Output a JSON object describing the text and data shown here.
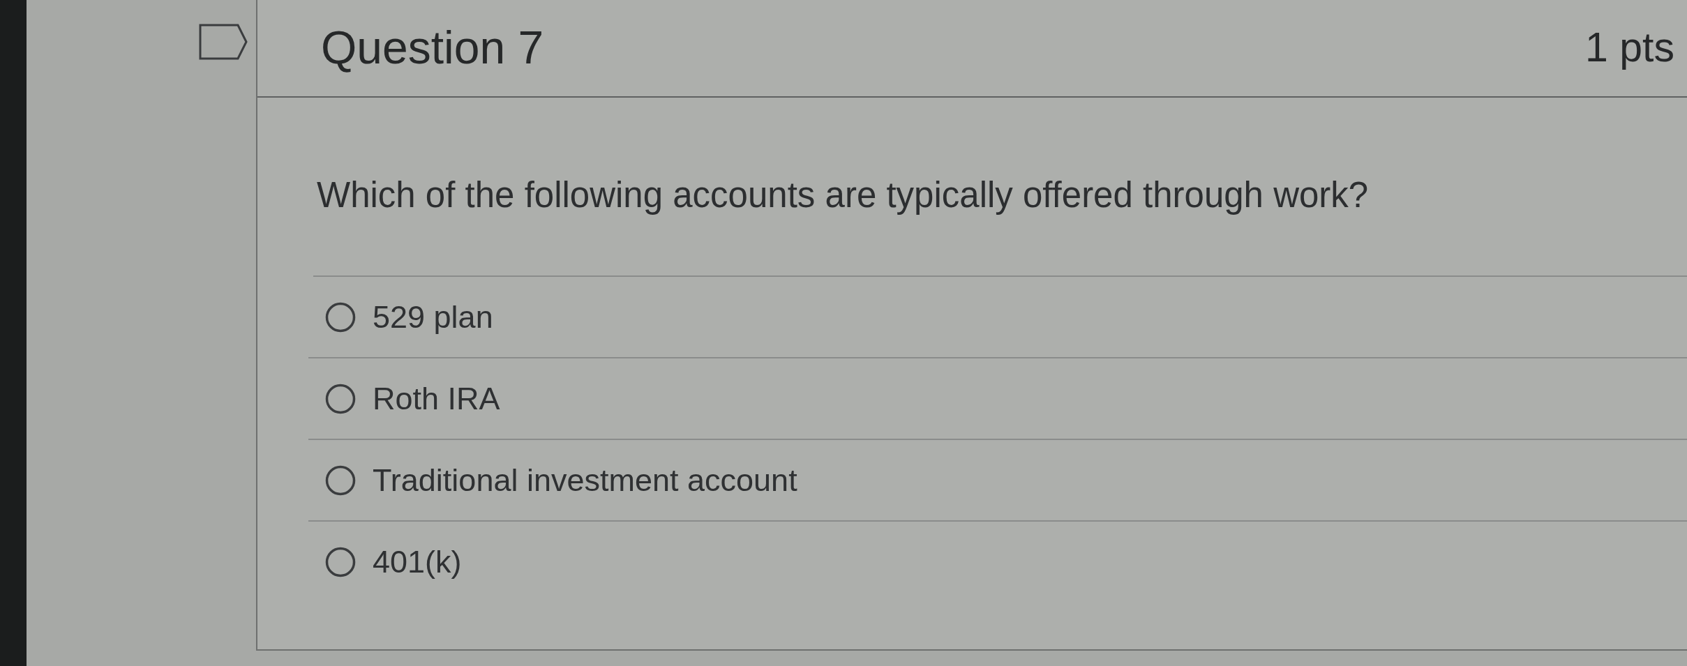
{
  "question": {
    "flagged": false,
    "title": "Question 7",
    "points": "1 pts",
    "text": "Which of the following accounts are typically offered through work?",
    "answers": [
      {
        "label": "529 plan",
        "selected": false
      },
      {
        "label": "Roth IRA",
        "selected": false
      },
      {
        "label": "Traditional investment account",
        "selected": false
      },
      {
        "label": "401(k)",
        "selected": false
      }
    ]
  }
}
